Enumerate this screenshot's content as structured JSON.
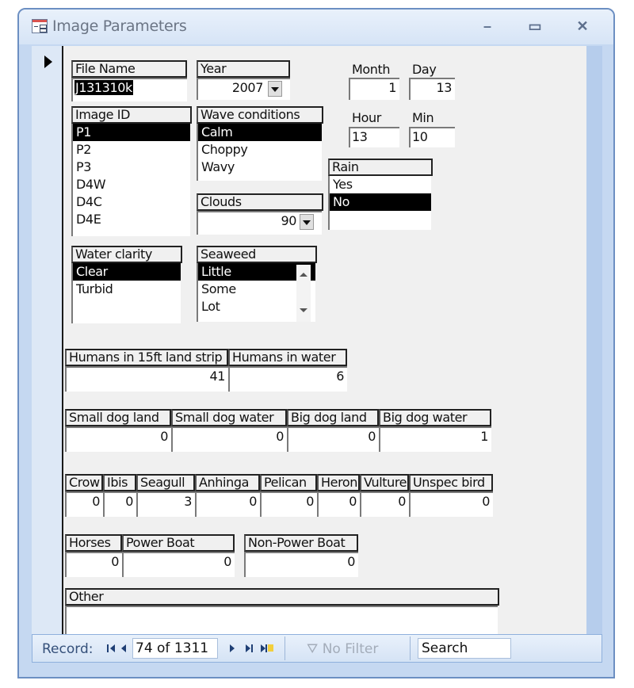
{
  "window": {
    "title": "Image Parameters",
    "icon": "form-icon",
    "controls": {
      "minimize": "–",
      "maximize": "▭",
      "close": "✕"
    }
  },
  "form": {
    "file_name": {
      "label": "File Name",
      "value": "J131310k"
    },
    "year": {
      "label": "Year",
      "value": "2007"
    },
    "month": {
      "label": "Month",
      "value": "1"
    },
    "day": {
      "label": "Day",
      "value": "13"
    },
    "hour": {
      "label": "Hour",
      "value": "13"
    },
    "min": {
      "label": "Min",
      "value": "10"
    },
    "image_id": {
      "label": "Image ID",
      "options": [
        "P1",
        "P2",
        "P3",
        "D4W",
        "D4C",
        "D4E"
      ],
      "selected": "P1"
    },
    "wave_conditions": {
      "label": "Wave conditions",
      "options": [
        "Calm",
        "Choppy",
        "Wavy"
      ],
      "selected": "Calm"
    },
    "clouds": {
      "label": "Clouds",
      "value": "90"
    },
    "rain": {
      "label": "Rain",
      "options": [
        "Yes",
        "No"
      ],
      "selected": "No"
    },
    "water_clarity": {
      "label": "Water clarity",
      "options": [
        "Clear",
        "Turbid"
      ],
      "selected": "Clear"
    },
    "seaweed": {
      "label": "Seaweed",
      "options": [
        "Little",
        "Some",
        "Lot"
      ],
      "selected": "Little"
    },
    "humans": [
      {
        "label": "Humans in 15ft land strip",
        "value": "41"
      },
      {
        "label": "Humans in water",
        "value": "6"
      }
    ],
    "dogs": [
      {
        "label": "Small dog land",
        "value": "0"
      },
      {
        "label": "Small dog water",
        "value": "0"
      },
      {
        "label": "Big dog land",
        "value": "0"
      },
      {
        "label": "Big dog water",
        "value": "1"
      }
    ],
    "birds": [
      {
        "label": "Crow",
        "value": "0"
      },
      {
        "label": "Ibis",
        "value": "0"
      },
      {
        "label": "Seagull",
        "value": "3"
      },
      {
        "label": "Anhinga",
        "value": "0"
      },
      {
        "label": "Pelican",
        "value": "0"
      },
      {
        "label": "Heron",
        "value": "0"
      },
      {
        "label": "Vulture",
        "value": "0"
      },
      {
        "label": "Unspec bird",
        "value": "0"
      }
    ],
    "other_counts": [
      {
        "label": "Horses",
        "value": "0"
      },
      {
        "label": "Power Boat",
        "value": "0"
      },
      {
        "label": "Non-Power Boat",
        "value": "0"
      }
    ],
    "other": {
      "label": "Other",
      "value": ""
    }
  },
  "navigation": {
    "record_label": "Record:",
    "current": "74 of 1311",
    "filter_label": "No Filter",
    "search_placeholder": "Search"
  }
}
